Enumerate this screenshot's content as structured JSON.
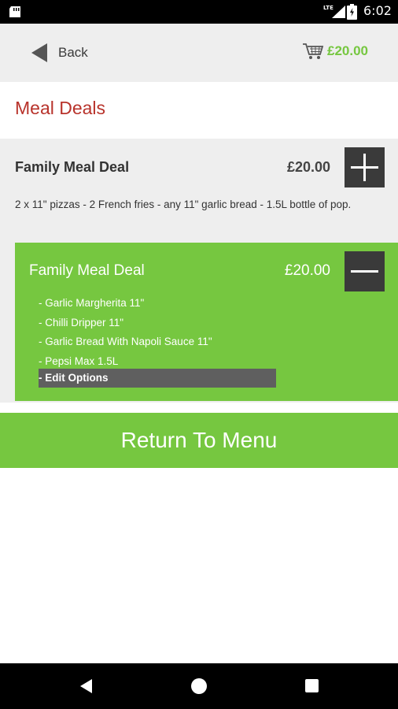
{
  "status_bar": {
    "network": "LTE",
    "time": "6:02"
  },
  "header": {
    "back_label": "Back",
    "cart_total": "£20.00"
  },
  "page_title": "Meal Deals",
  "deal": {
    "name": "Family Meal Deal",
    "price": "£20.00",
    "description": "2 x 11\" pizzas - 2 French fries - any 11\" garlic bread - 1.5L bottle of pop."
  },
  "selected": {
    "name": "Family Meal Deal",
    "price": "£20.00",
    "items": [
      "- Garlic Margherita 11\"",
      "- Chilli Dripper 11\"",
      "- Garlic Bread With Napoli Sauce 11\"",
      "- Pepsi Max 1.5L"
    ],
    "edit_label": "- Edit Options"
  },
  "return_label": "Return To Menu",
  "colors": {
    "accent_green": "#76c740",
    "title_red": "#b8332b",
    "dark_button": "#3a3a3a"
  }
}
